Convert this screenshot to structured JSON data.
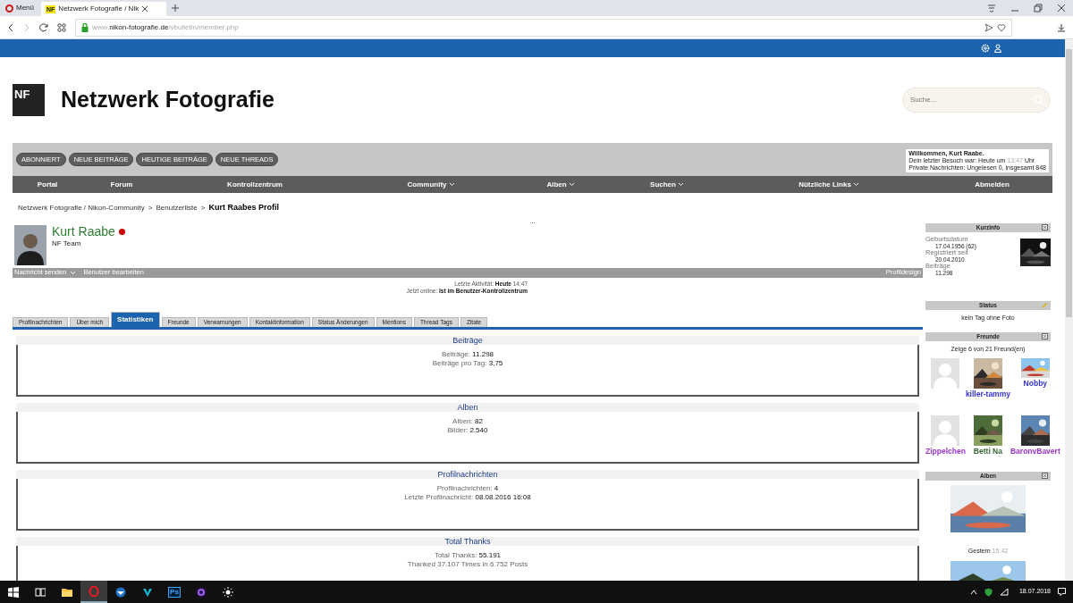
{
  "browser": {
    "menu_label": "Menü",
    "tab": {
      "favicon_text": "NF",
      "title": "Netzwerk Fotografie / Nik"
    },
    "url": {
      "prefix": "www.",
      "domain": "nikon-fotografie.de",
      "path": "/vbulletin/member.php"
    }
  },
  "header": {
    "logo_text": "NF",
    "site_title": "Netzwerk Fotografie",
    "search": {
      "placeholder": "Suche..."
    }
  },
  "toolbar": {
    "buttons": [
      "ABONNIERT",
      "NEUE BEITRÄGE",
      "HEUTIGE BEITRÄGE",
      "NEUE THREADS"
    ],
    "welcome": {
      "greeting": "Willkommen, Kurt Raabe.",
      "visit_label": "Dein letzter Besuch war: Heute um",
      "visit_time": "13:47",
      "visit_suffix": "Uhr",
      "messages": "Private Nachrichten: Ungelesen 0, insgesamt 848"
    }
  },
  "nav": [
    {
      "label": "Portal",
      "has_menu": false
    },
    {
      "label": "Forum",
      "has_menu": false
    },
    {
      "label": "Kontrollzentrum",
      "has_menu": false
    },
    {
      "label": "Community",
      "has_menu": true
    },
    {
      "label": "Alben",
      "has_menu": true
    },
    {
      "label": "Suchen",
      "has_menu": true
    },
    {
      "label": "Nützliche Links",
      "has_menu": true
    },
    {
      "label": "Abmelden",
      "has_menu": false
    }
  ],
  "breadcrumb": {
    "links": [
      "Netzwerk Fotografie / Nikon-Community",
      "Benutzerliste"
    ],
    "separator": ">",
    "current": "Kurt Raabes Profil"
  },
  "more": "...",
  "profile": {
    "name": "Kurt Raabe",
    "online_indicator": true,
    "rank": "NF Team",
    "actions": [
      {
        "label": "Nachricht senden",
        "has_menu": true
      },
      {
        "label": "Benutzer bearbeiten",
        "has_menu": false
      }
    ],
    "design_link": "Profildesign",
    "activity": [
      {
        "label": "Letzte Aktivität:",
        "value": "Heute",
        "extra": "14:47"
      },
      {
        "label": "Jetzt online:",
        "value": "Ist im Benutzer-Kontrollzentrum"
      }
    ]
  },
  "tabs": [
    {
      "label": "Profilnachrichten",
      "selected": false
    },
    {
      "label": "Über mich",
      "selected": false
    },
    {
      "label": "Statistiken",
      "selected": true
    },
    {
      "label": "Freunde",
      "selected": false
    },
    {
      "label": "Verwarnungen",
      "selected": false
    },
    {
      "label": "Kontaktinformation",
      "selected": false
    },
    {
      "label": "Status Änderungen",
      "selected": false
    },
    {
      "label": "Mentions",
      "selected": false
    },
    {
      "label": "Thread Tags",
      "selected": false
    },
    {
      "label": "Zitate",
      "selected": false
    }
  ],
  "sections": [
    {
      "title": "Beiträge",
      "lines": [
        {
          "label": "Beiträge:",
          "value": "11.298"
        },
        {
          "label": "Beiträge pro Tag:",
          "value": "3,75"
        }
      ]
    },
    {
      "title": "Alben",
      "lines": [
        {
          "label": "Alben:",
          "value": "82"
        },
        {
          "label": "Bilder:",
          "value": "2.540"
        }
      ]
    },
    {
      "title": "Profilnachrichten",
      "lines": [
        {
          "label": "Profilnachrichten:",
          "value": "4"
        },
        {
          "label": "Letzte Profilnachricht:",
          "value": "08.08.2016 16:08"
        }
      ]
    },
    {
      "title": "Total Thanks",
      "lines": [
        {
          "label": "Total Thanks:",
          "value": "55.191"
        },
        {
          "label": "Thanked 37.107 Times in 6.752 Posts"
        }
      ]
    }
  ],
  "sidebar": {
    "kurzinfo": {
      "title": "Kurzinfo",
      "rows": [
        {
          "label": "Geburtsdatum",
          "value": "17.04.1956 (62)"
        },
        {
          "label": "Registriert seit",
          "value": "20.04.2010"
        },
        {
          "label": "Beiträge",
          "value": "11.298"
        }
      ]
    },
    "status": {
      "title": "Status",
      "text": "kein Tag ohne Foto"
    },
    "friends": {
      "title": "Freunde",
      "summary": "Zeige 6 von 21 Freund(en)",
      "items": [
        {
          "kind": "default"
        },
        {
          "kind": "picture",
          "name": "killer-tammy",
          "color": "#3333cc"
        },
        {
          "kind": "picture",
          "name": "Nobby",
          "color": "#3333cc"
        },
        {
          "kind": "default",
          "name": "Zippelchen",
          "color": "#9933cc"
        },
        {
          "kind": "picture",
          "name": "Betti Na",
          "color": "#336633"
        },
        {
          "kind": "picture",
          "name": "BaronvBavert",
          "color": "#9933cc"
        }
      ]
    },
    "albums": {
      "title": "Alben",
      "caption_day": "Gestern",
      "caption_time": "15:42"
    }
  },
  "taskbar": {
    "apps": [
      {
        "kind": "task-view",
        "active": false
      },
      {
        "kind": "folder",
        "active": false
      },
      {
        "kind": "opera",
        "active": true
      },
      {
        "kind": "mail",
        "active": false
      },
      {
        "kind": "vector",
        "active": false
      },
      {
        "kind": "photoshop",
        "label": "Ps",
        "active": false
      },
      {
        "kind": "ring",
        "active": false
      },
      {
        "kind": "sun",
        "active": false
      }
    ],
    "date": "18.07.2018"
  }
}
